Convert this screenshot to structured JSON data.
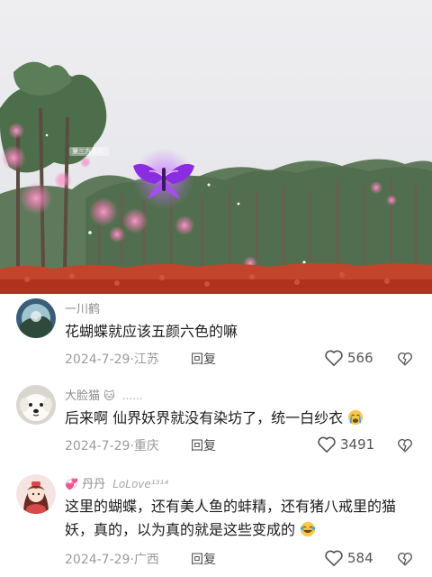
{
  "video": {
    "caption_tag": "第三方水印"
  },
  "comments": [
    {
      "username": "一川鹤",
      "username_extra": "",
      "text": "花蝴蝶就应该五颜六色的嘛",
      "date": "2024-7-29",
      "location": "江苏",
      "reply_label": "回复",
      "likes": "566",
      "avatar": "landscape-avatar"
    },
    {
      "username": "大脸猫",
      "username_extra": "......",
      "text": "后来啊 仙界妖界就没有染坊了，统一白纱衣",
      "date": "2024-7-29",
      "location": "重庆",
      "reply_label": "回复",
      "likes": "3491",
      "avatar": "white-dog-avatar"
    },
    {
      "username": "丹丹",
      "username_extra": "LoLove¹³¹⁴",
      "text": "这里的蝴蝶，还有美人鱼的蚌精，还有猪八戒里的猫妖，真的，以为真的就是这些变成的",
      "date": "2024-7-29",
      "location": "广西",
      "reply_label": "回复",
      "likes": "584",
      "avatar": "anime-girl-avatar"
    }
  ],
  "separator": "·",
  "colors": {
    "muted": "#9b9b9b",
    "text": "#1c1c1c",
    "ground": "#b1311f"
  }
}
